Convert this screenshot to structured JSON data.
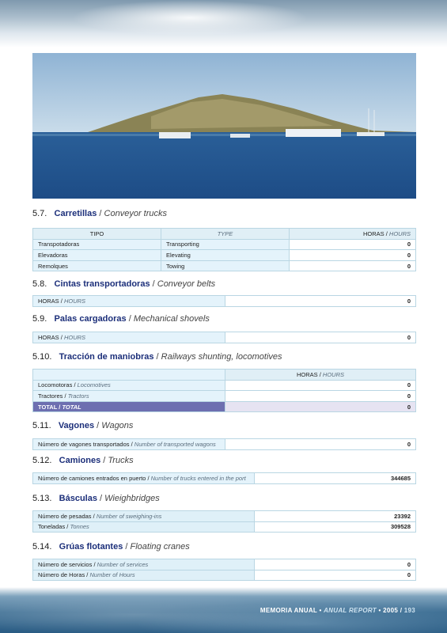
{
  "sections": {
    "s57": {
      "num": "5.7.",
      "es": "Carretillas",
      "en": "Conveyor trucks",
      "headers": {
        "tipo": "TIPO",
        "type": "TYPE",
        "horas": "HORAS",
        "hours": "HOURS"
      },
      "rows": [
        {
          "es": "Transpotadoras",
          "en": "Transporting",
          "value": "0"
        },
        {
          "es": "Elevadoras",
          "en": "Elevating",
          "value": "0"
        },
        {
          "es": "Remolques",
          "en": "Towing",
          "value": "0"
        }
      ]
    },
    "s58": {
      "num": "5.8.",
      "es": "Cintas transportadoras",
      "en": "Conveyor belts",
      "row": {
        "es": "HORAS",
        "en": "HOURS",
        "value": "0"
      }
    },
    "s59": {
      "num": "5.9.",
      "es": "Palas cargadoras",
      "en": "Mechanical shovels",
      "row": {
        "es": "HORAS",
        "en": "HOURS",
        "value": "0"
      }
    },
    "s510": {
      "num": "5.10.",
      "es": "Tracción de maniobras",
      "en": "Railways shunting, locomotives",
      "headers": {
        "horas": "HORAS",
        "hours": "HOURS"
      },
      "rows": [
        {
          "es": "Locomotoras",
          "en": "Locomotives",
          "value": "0"
        },
        {
          "es": "Tractores",
          "en": "Tractors",
          "value": "0"
        }
      ],
      "total": {
        "es": "TOTAL",
        "en": "TOTAL",
        "value": "0"
      }
    },
    "s511": {
      "num": "5.11.",
      "es": "Vagones",
      "en": "Wagons",
      "row": {
        "es": "Número de vagones transportados",
        "en": "Number of transported wagons",
        "value": "0"
      }
    },
    "s512": {
      "num": "5.12.",
      "es": "Camiones",
      "en": "Trucks",
      "row": {
        "es": "Número de camiones entrados en puerto",
        "en": "Number of trucks entered in the port",
        "value": "344685"
      }
    },
    "s513": {
      "num": "5.13.",
      "es": "Básculas",
      "en": "Wieighbridges",
      "rows": [
        {
          "es": "Número de pesadas",
          "en": "Number of  sweighing-ins",
          "value": "23392"
        },
        {
          "es": "Toneladas",
          "en": "Tonnes",
          "value": "309528"
        }
      ]
    },
    "s514": {
      "num": "5.14.",
      "es": "Grúas flotantes",
      "en": "Floating cranes",
      "rows": [
        {
          "es": "Número de servicios",
          "en": "Number of  services",
          "value": "0"
        },
        {
          "es": "Número de Horas",
          "en": "Number of  Hours",
          "value": "0"
        }
      ]
    }
  },
  "sep": "/",
  "footer": {
    "memoria": "MEMORIA ANUAL",
    "bullet": "•",
    "report": "ANUAL REPORT",
    "year": "2005",
    "page": "193"
  }
}
